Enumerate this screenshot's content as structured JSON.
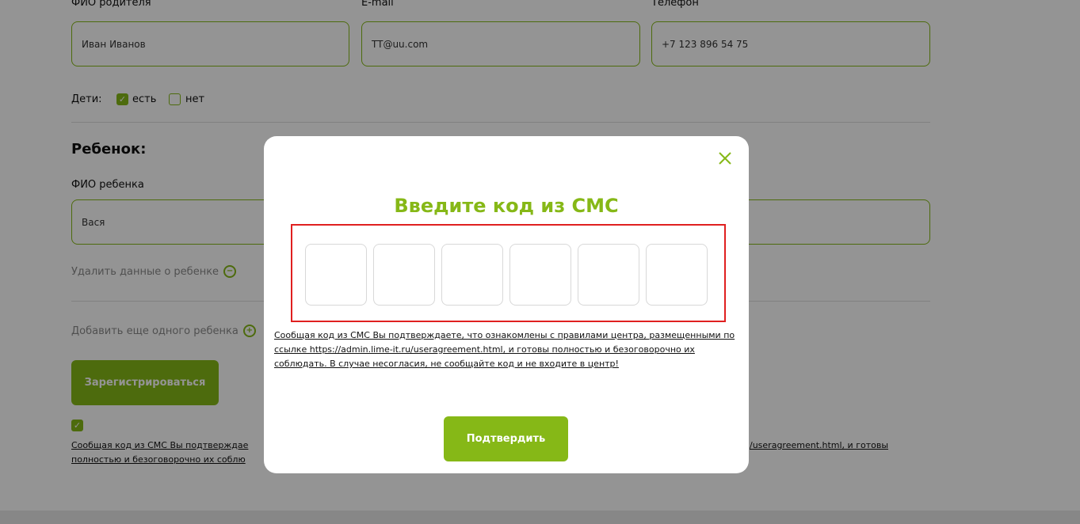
{
  "form": {
    "parent": {
      "name_label": "ФИО родителя",
      "name_value": "Иван Иванов",
      "email_label": "E-mail",
      "email_value": "TT@uu.com",
      "phone_label": "Телефон",
      "phone_value": "+7 123 896 54 75"
    },
    "children_row": {
      "label": "Дети:",
      "yes_label": "есть",
      "yes_checked": true,
      "no_label": "нет",
      "no_checked": false
    },
    "child": {
      "section_title": "Ребенок:",
      "name_label": "ФИО ребенка",
      "name_value": "Вася",
      "delete_link": "Удалить данные о ребенке",
      "add_link": "Добавить еще одного ребенка"
    },
    "register_button": "Зарегистрироваться",
    "agree_checked": true,
    "agree_text_line1_left": "Сообщая код из СМС Вы подтверждае",
    "agree_text_line1_right": "/useragreement.html, и готовы",
    "agree_text_line2_left": "полностью и безоговорочно их соблю"
  },
  "modal": {
    "title": "Введите код из СМС",
    "code_cells": [
      "",
      "",
      "",
      "",
      "",
      ""
    ],
    "agreement_text": "Сообщая код из СМС Вы подтверждаете, что ознакомлены с правилами центра, размещенными по ссылке https://admin.lime-it.ru/useragreement.html, и готовы полностью и безоговорочно их соблюдать. В случае несогласия, не сообщайте код и не входите в центр!",
    "confirm_button": "Подтвердить"
  },
  "colors": {
    "accent": "#86b817",
    "highlight_box": "#e02020",
    "overlay": "rgba(0,0,0,0.42)"
  },
  "icons": {
    "close": "close-icon",
    "minus_circle": "minus-circle-icon",
    "plus_circle": "plus-circle-icon",
    "check": "check-icon"
  }
}
